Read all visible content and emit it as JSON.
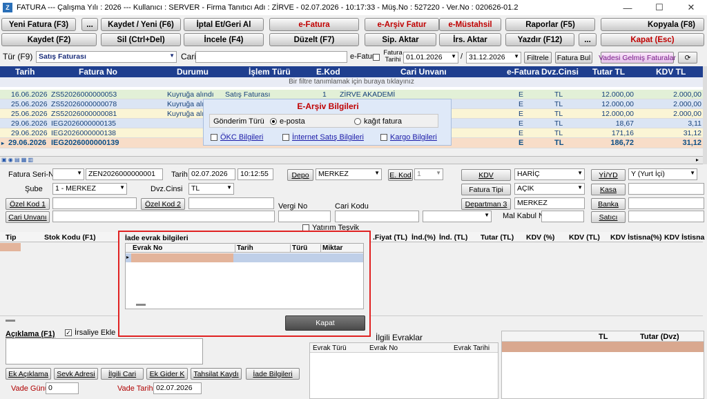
{
  "title": "FATURA  ---  Çalışma Yılı : 2026  ---  Kullanıcı : SERVER - Firma Tanıtıcı Adı : ZİRVE - 02.07.2026 - 10:17:33 - Müş.No : 527220 - Ver.No : 020626-01.2",
  "toolbar": {
    "row1": [
      "Yeni Fatura (F3)",
      "...",
      "Kaydet / Yeni (F6)",
      "İptal Et/Geri Al",
      "e-Fatura",
      "e-Arşiv Fatur",
      "e-Müstahsil",
      "Raporlar (F5)",
      "Kopyala (F8)"
    ],
    "row2": [
      "Kaydet (F2)",
      "Sil (Ctrl+Del)",
      "İncele (F4)",
      "Düzelt (F7)",
      "Sip. Aktar",
      "İrs. Aktar",
      "Yazdır (F12)",
      "...",
      "Kapat (Esc)"
    ]
  },
  "filterbar": {
    "tur_label": "Tür (F9)",
    "tur_value": "Satış Faturası",
    "cari_label": "Cari",
    "efatura_label": "e-Fatura",
    "fatura_tarihi_label": "Fatura Tarihi",
    "date_from": "01.01.2026",
    "slash": "/",
    "date_to": "31.12.2026",
    "filtrele": "Filtrele",
    "fatura_bul": "Fatura Bul",
    "vadesi": "Vadesi Gelmiş Faturalar",
    "refresh": "⟳"
  },
  "grid": {
    "headers": [
      "Tarih",
      "Fatura No",
      "Durumu",
      "İşlem Türü",
      "E.Kod",
      "Cari Unvanı",
      "e-Fatura",
      "Dvz.Cinsi",
      "Tutar TL",
      "KDV TL"
    ],
    "filter_text": "Bir filtre tanımlamak için buraya tıklayınız",
    "rows": [
      {
        "tarih": "16.06.2026",
        "no": "ZS52026000000053",
        "durum": "Kuyruğa alındı",
        "islem": "Satış Faturası",
        "ekod": "1",
        "cari": "ZİRVE AKADEMİ",
        "ef": "E",
        "dvz": "TL",
        "tutar": "12.000,00",
        "kdv": "2.000,00"
      },
      {
        "tarih": "25.06.2026",
        "no": "ZS52026000000078",
        "durum": "Kuyruğa alı",
        "islem": "",
        "ekod": "",
        "cari": "",
        "ef": "E",
        "dvz": "TL",
        "tutar": "12.000,00",
        "kdv": "2.000,00"
      },
      {
        "tarih": "25.06.2026",
        "no": "ZS52026000000081",
        "durum": "Kuyruğa alı",
        "islem": "",
        "ekod": "",
        "cari": "",
        "ef": "E",
        "dvz": "TL",
        "tutar": "12.000,00",
        "kdv": "2.000,00"
      },
      {
        "tarih": "29.06.2026",
        "no": "IEG2026000000135",
        "durum": "",
        "islem": "",
        "ekod": "",
        "cari": "",
        "ef": "E",
        "dvz": "TL",
        "tutar": "18,67",
        "kdv": "3,11"
      },
      {
        "tarih": "29.06.2026",
        "no": "IEG2026000000138",
        "durum": "",
        "islem": "",
        "ekod": "",
        "cari": "",
        "ef": "E",
        "dvz": "TL",
        "tutar": "171,16",
        "kdv": "31,12"
      },
      {
        "tarih": "29.06.2026",
        "no": "IEG2026000000139",
        "durum": "",
        "islem": "",
        "ekod": "",
        "cari": "",
        "ef": "E",
        "dvz": "TL",
        "tutar": "186,72",
        "kdv": "31,12"
      }
    ]
  },
  "earsiv": {
    "title": "E-Arşiv Bilgileri",
    "gonderim_label": "Gönderim Türü",
    "opt1": "e-posta",
    "opt2": "kağıt fatura",
    "okc": "ÖKC Bilgileri",
    "internet": "İnternet Satış Bilgileri",
    "kargo": "Kargo Bilgileri"
  },
  "form": {
    "seri_label": "Fatura Seri-No",
    "fatura_no": "ZEN2026000000001",
    "tarih_label": "Tarih",
    "tarih": "02.07.2026",
    "saat": "10:12:55",
    "depo": "Depo",
    "depo_val": "MERKEZ",
    "ekod": "E. Kod",
    "ekod_val": "1",
    "kdv": "KDV",
    "kdv_val": "HARİÇ",
    "yiyd": "Yİ/YD",
    "yiyd_val": "Y (Yurt İçi)",
    "sube_label": "Şube",
    "sube_val": "1 - MERKEZ",
    "dvz_label": "Dvz.Cinsi",
    "dvz_val": "TL",
    "fatura_tipi": "Fatura Tipi",
    "fatura_tipi_val": "AÇIK",
    "kasa": "Kasa",
    "ozel1": "Özel Kod 1",
    "ozel2": "Özel Kod 2",
    "departman": "Departman 3",
    "departman_val": "MERKEZ",
    "banka": "Banka",
    "vergi": "Vergi No",
    "carikodu": "Cari Kodu",
    "cari_unvani": "Cari Unvanı",
    "malkabul": "Mal Kabul No",
    "satici": "Satıcı",
    "yatirim": "Yatırım Teşvik"
  },
  "detail_headers": [
    "Tip",
    "Stok Kodu (F1)",
    ".Fiyat (TL)",
    "İnd.(%)",
    "İnd. (TL)",
    "Tutar (TL)",
    "KDV (%)",
    "KDV (TL)",
    "KDV İstisna(%)",
    "KDV İstisna"
  ],
  "iade": {
    "title": "İade evrak bilgileri",
    "cols": [
      "Evrak No",
      "Tarih",
      "Türü",
      "Miktar"
    ],
    "kapat": "Kapat"
  },
  "bottom": {
    "aciklama": "Açıklama (F1)",
    "irsaliye": "İrsaliye Ekle",
    "buttons": [
      "Ek Açıklama",
      "Sevk Adresi",
      "İlgili Cari",
      "Ek Gider K",
      "Tahsilat Kaydı",
      "İade Bilgileri"
    ],
    "vade_gunu": "Vade Günü",
    "vade_gunu_val": "0",
    "vade_tarihi": "Vade Tarihi",
    "vade_tarihi_val": "02.07.2026",
    "ilgili": "İlgili Evraklar",
    "ilgili_cols": [
      "Evrak Türü",
      "Evrak No",
      "Evrak Tarihi"
    ],
    "tot_cols": [
      "TL",
      "Tutar (Dvz)"
    ]
  }
}
